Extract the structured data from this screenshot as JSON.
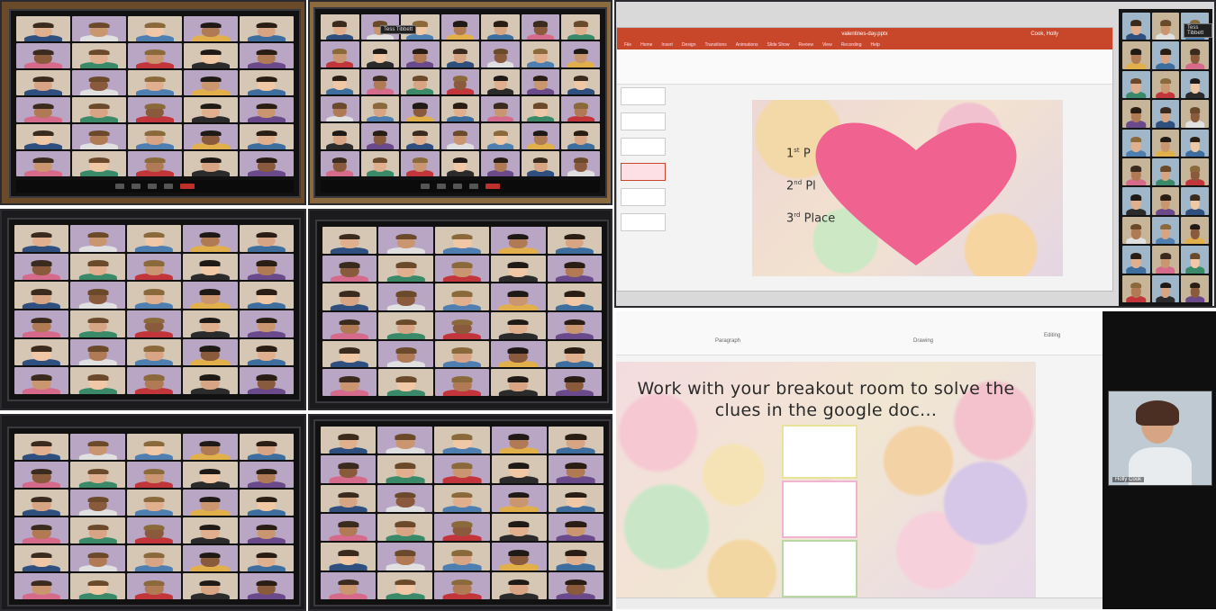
{
  "panels": {
    "photo1": {
      "tile_label": "",
      "tiles": 25
    },
    "photo2": {
      "name_tag": "Tess Tibbett"
    },
    "photo3": {
      "tiles": 25
    },
    "photo4": {
      "tiles": 25
    },
    "photo5": {
      "tiles": 25
    },
    "photo6": {
      "tiles": 25
    }
  },
  "powerpoint": {
    "title": "valentines-day.pptx",
    "user": "Cook, Holly",
    "tabs": [
      "File",
      "Home",
      "Insert",
      "Design",
      "Transitions",
      "Animations",
      "Slide Show",
      "Review",
      "View",
      "Recording",
      "Help"
    ],
    "places": [
      {
        "num": "1",
        "suffix": "st",
        "text": "P"
      },
      {
        "num": "2",
        "suffix": "nd",
        "text": "Pl"
      },
      {
        "num": "3",
        "suffix": "rd",
        "text": "Place"
      }
    ],
    "heart_color": "#f0628f"
  },
  "side_gallery": {
    "name_tag": "Tess Tibbett"
  },
  "breakout": {
    "line1": "Work with your breakout room to solve the",
    "line2": "clues in the google doc...",
    "ribbon_labels": [
      "Paragraph",
      "Drawing",
      "Editing"
    ]
  },
  "teacher": {
    "name": "Holly Cook"
  },
  "colors": {
    "accent": "#c8472b",
    "leave": "#c0302b",
    "candy_pink": "#f6c9d2",
    "candy_green": "#c9e7c7",
    "candy_yellow": "#f3d7a2"
  }
}
